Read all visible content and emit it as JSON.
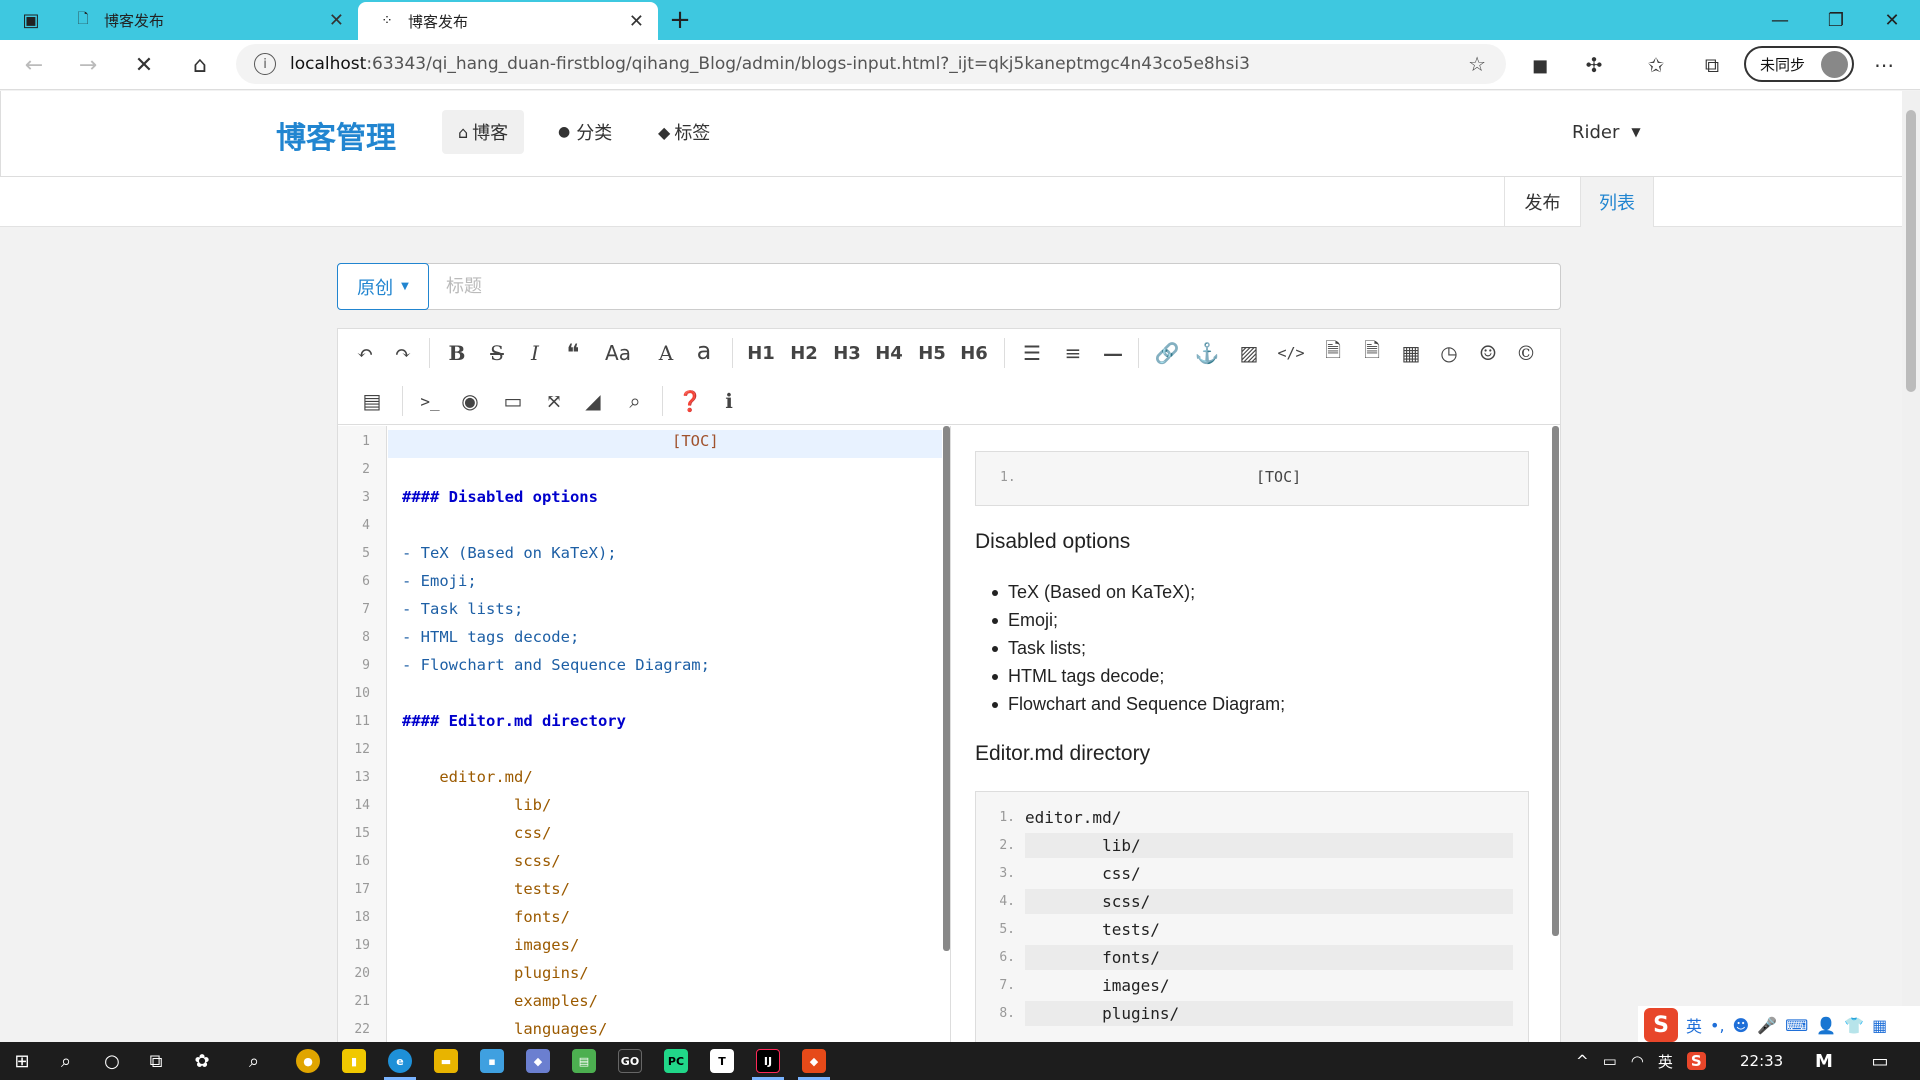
{
  "browser": {
    "tabs": [
      {
        "title": "博客发布"
      },
      {
        "title": "博客发布"
      }
    ],
    "url_host": "localhost",
    "url_rest": ":63343/qi_hang_duan-firstblog/qihang_Blog/admin/blogs-input.html?_ijt=qkj5kaneptmgc4n43co5e8hsi3",
    "sync_label": "未同步"
  },
  "nav": {
    "brand": "博客管理",
    "items": [
      {
        "label": "博客",
        "icon": "home-icon"
      },
      {
        "label": "分类",
        "icon": "idea-icon"
      },
      {
        "label": "标签",
        "icon": "tags-icon"
      }
    ],
    "user": "Rider"
  },
  "subnav": {
    "publish": "发布",
    "list": "列表"
  },
  "form": {
    "type_label": "原创",
    "title_placeholder": "标题",
    "title_value": ""
  },
  "toolbar": {
    "headings": [
      "H1",
      "H2",
      "H3",
      "H4",
      "H5",
      "H6"
    ],
    "case_upper": "Aa",
    "case_a": "A",
    "case_lower": "a"
  },
  "editor": {
    "lines": [
      {
        "n": "1",
        "text": "[TOC]",
        "cls": "c-toc"
      },
      {
        "n": "2",
        "text": "",
        "cls": ""
      },
      {
        "n": "3",
        "text": "#### Disabled options",
        "cls": "c-h"
      },
      {
        "n": "4",
        "text": "",
        "cls": ""
      },
      {
        "n": "5",
        "text": "- TeX (Based on KaTeX);",
        "cls": "c-li"
      },
      {
        "n": "6",
        "text": "- Emoji;",
        "cls": "c-li"
      },
      {
        "n": "7",
        "text": "- Task lists;",
        "cls": "c-li"
      },
      {
        "n": "8",
        "text": "- HTML tags decode;",
        "cls": "c-li"
      },
      {
        "n": "9",
        "text": "- Flowchart and Sequence Diagram;",
        "cls": "c-li"
      },
      {
        "n": "10",
        "text": "",
        "cls": ""
      },
      {
        "n": "11",
        "text": "#### Editor.md directory",
        "cls": "c-h"
      },
      {
        "n": "12",
        "text": "",
        "cls": ""
      },
      {
        "n": "13",
        "text": "    editor.md/",
        "cls": "c-dir"
      },
      {
        "n": "14",
        "text": "            lib/",
        "cls": "c-dir"
      },
      {
        "n": "15",
        "text": "            css/",
        "cls": "c-dir"
      },
      {
        "n": "16",
        "text": "            scss/",
        "cls": "c-dir"
      },
      {
        "n": "17",
        "text": "            tests/",
        "cls": "c-dir"
      },
      {
        "n": "18",
        "text": "            fonts/",
        "cls": "c-dir"
      },
      {
        "n": "19",
        "text": "            images/",
        "cls": "c-dir"
      },
      {
        "n": "20",
        "text": "            plugins/",
        "cls": "c-dir"
      },
      {
        "n": "21",
        "text": "            examples/",
        "cls": "c-dir"
      },
      {
        "n": "22",
        "text": "            languages/",
        "cls": "c-dir"
      }
    ]
  },
  "preview": {
    "toc_num": "1.",
    "toc_text": "[TOC]",
    "h_disabled": "Disabled options",
    "disabled_items": [
      "TeX (Based on KaTeX);",
      "Emoji;",
      "Task lists;",
      "HTML tags decode;",
      "Flowchart and Sequence Diagram;"
    ],
    "h_directory": "Editor.md directory",
    "code_lines": [
      {
        "n": "1.",
        "text": "editor.md/"
      },
      {
        "n": "2.",
        "text": "        lib/"
      },
      {
        "n": "3.",
        "text": "        css/"
      },
      {
        "n": "4.",
        "text": "        scss/"
      },
      {
        "n": "5.",
        "text": "        tests/"
      },
      {
        "n": "6.",
        "text": "        fonts/"
      },
      {
        "n": "7.",
        "text": "        images/"
      },
      {
        "n": "8.",
        "text": "        plugins/"
      }
    ]
  },
  "ime": {
    "lang": "英"
  },
  "taskbar": {
    "lang": "英",
    "time": "22:33"
  }
}
